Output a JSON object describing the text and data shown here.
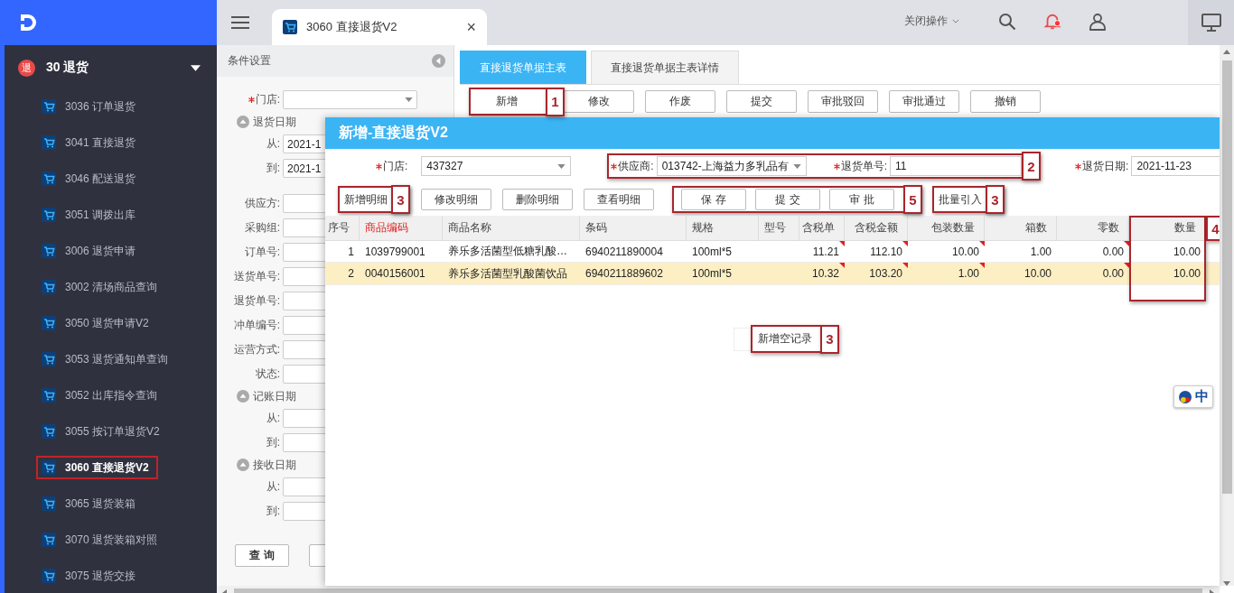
{
  "sidebar": {
    "group": {
      "label": "30 退货",
      "badge": "退",
      "expanded": true
    },
    "items": [
      {
        "label": "3036 订单退货",
        "selected": false
      },
      {
        "label": "3041 直接退货",
        "selected": false
      },
      {
        "label": "3046 配送退货",
        "selected": false
      },
      {
        "label": "3051 调拨出库",
        "selected": false
      },
      {
        "label": "3006 退货申请",
        "selected": false
      },
      {
        "label": "3002 清场商品查询",
        "selected": false
      },
      {
        "label": "3050 退货申请V2",
        "selected": false
      },
      {
        "label": "3053 退货通知单查询",
        "selected": false
      },
      {
        "label": "3052 出库指令查询",
        "selected": false
      },
      {
        "label": "3055 按订单退货V2",
        "selected": false
      },
      {
        "label": "3060 直接退货V2",
        "selected": true,
        "highlighted": true
      },
      {
        "label": "3065 退货装箱",
        "selected": false
      },
      {
        "label": "3070 退货装箱对照",
        "selected": false
      },
      {
        "label": "3075 退货交接",
        "selected": false
      }
    ]
  },
  "topbar": {
    "tab": {
      "label": "3060 直接退货V2",
      "close": "×"
    },
    "close_ops": "关闭操作",
    "bell_unread": true
  },
  "conditions": {
    "title": "条件设置",
    "rows": [
      {
        "kind": "select",
        "label": "门店:",
        "required": true
      },
      {
        "kind": "group",
        "label": "退货日期",
        "expanded": true
      },
      {
        "kind": "field",
        "label": "从:",
        "value": "2021-1"
      },
      {
        "kind": "field",
        "label": "到:",
        "value": "2021-1"
      },
      {
        "kind": "spacer"
      },
      {
        "kind": "field",
        "label": "供应方:"
      },
      {
        "kind": "field",
        "label": "采购组:"
      },
      {
        "kind": "field",
        "label": "订单号:"
      },
      {
        "kind": "field",
        "label": "送货单号:"
      },
      {
        "kind": "field",
        "label": "退货单号:"
      },
      {
        "kind": "field",
        "label": "冲单编号:"
      },
      {
        "kind": "field",
        "label": "运营方式:"
      },
      {
        "kind": "field",
        "label": "状态:"
      },
      {
        "kind": "group",
        "label": "记账日期",
        "expanded": true
      },
      {
        "kind": "field",
        "label": "从:"
      },
      {
        "kind": "field",
        "label": "到:"
      },
      {
        "kind": "group",
        "label": "接收日期",
        "expanded": true
      },
      {
        "kind": "field",
        "label": "从:"
      },
      {
        "kind": "field",
        "label": "到:"
      },
      {
        "kind": "buttons",
        "buttons": [
          "查 询"
        ],
        "cut_button": true
      }
    ]
  },
  "content": {
    "tabs": [
      {
        "label": "直接退货单据主表",
        "selected": true
      },
      {
        "label": "直接退货单据主表详情",
        "selected": false
      }
    ],
    "buttons": [
      {
        "label": "新增",
        "callout": "1"
      },
      {
        "label": "修改"
      },
      {
        "label": "作废"
      },
      {
        "label": "提交"
      },
      {
        "label": "审批驳回"
      },
      {
        "label": "审批通过"
      },
      {
        "label": "撤销"
      }
    ]
  },
  "dialog": {
    "title": "新增-直接退货V2",
    "field_groups": [
      {
        "fields": [
          {
            "label": "门店:",
            "required": true,
            "kind": "select",
            "value": "437327"
          }
        ]
      },
      {
        "callout": "2",
        "fields": [
          {
            "label": "供应商:",
            "required": true,
            "kind": "select",
            "value": "013742-上海益力多乳品有"
          },
          {
            "label": "退货单号:",
            "required": true,
            "kind": "input",
            "value": "11"
          }
        ]
      },
      {
        "fields": [
          {
            "label": "退货日期:",
            "required": true,
            "kind": "input",
            "value": "2021-11-23"
          }
        ]
      }
    ],
    "button_groups": [
      {
        "callout": "3",
        "buttons": [
          "新增明细"
        ]
      },
      {
        "buttons": [
          "修改明细"
        ]
      },
      {
        "buttons": [
          "删除明细"
        ]
      },
      {
        "buttons": [
          "查看明细"
        ]
      },
      {
        "callout": "5",
        "buttons": [
          "保 存",
          "提 交",
          "审 批"
        ]
      },
      {
        "callout": "3",
        "buttons": [
          "批量引入"
        ]
      }
    ],
    "table": {
      "columns": [
        {
          "label": "序号",
          "numeric": true
        },
        {
          "label": "商品编码",
          "required": true
        },
        {
          "label": "商品名称"
        },
        {
          "label": "条码"
        },
        {
          "label": "规格"
        },
        {
          "label": "型号"
        },
        {
          "label": "含税单",
          "numeric": true,
          "corner": true
        },
        {
          "label": "含税金额",
          "numeric": true,
          "corner": true
        },
        {
          "label": "包装数量",
          "numeric": true,
          "corner": true
        },
        {
          "label": "箱数",
          "numeric": true
        },
        {
          "label": "零数",
          "numeric": true,
          "corner": true
        },
        {
          "label": "数量",
          "numeric": true,
          "callout": "4"
        }
      ],
      "rows": [
        {
          "selected": false,
          "cells": [
            "1",
            "1039799001",
            "养乐多活菌型低糖乳酸…",
            "6940211890004",
            "100ml*5",
            "",
            "11.21",
            "112.10",
            "10.00",
            "1.00",
            "0.00",
            "10.00"
          ]
        },
        {
          "selected": true,
          "cells": [
            "2",
            "0040156001",
            "养乐多活菌型乳酸菌饮品",
            "6940211889602",
            "100ml*5",
            "",
            "10.32",
            "103.20",
            "1.00",
            "10.00",
            "0.00",
            "10.00"
          ]
        }
      ]
    },
    "add_empty": {
      "label": "新增空记录",
      "callout": "3"
    }
  },
  "ime": {
    "label": "中"
  }
}
